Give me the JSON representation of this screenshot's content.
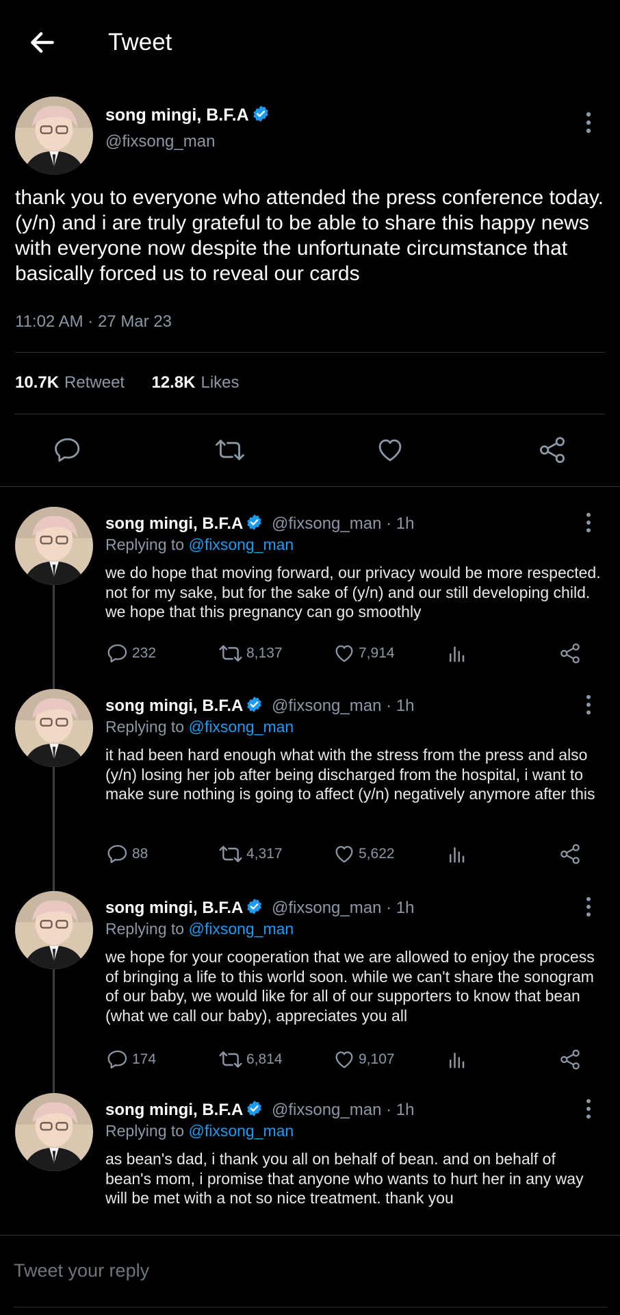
{
  "header": {
    "title": "Tweet"
  },
  "main_tweet": {
    "name": "song mingi, B.F.A",
    "handle": "@fixsong_man",
    "text": "thank you to everyone who attended the press conference today. (y/n) and i are truly grateful to be able to share this happy news with everyone now despite the unfortunate circumstance that basically forced us to reveal our cards",
    "timestamp": "11:02 AM · 27 Mar 23",
    "retweets_count": "10.7K",
    "retweets_label": "Retweet",
    "likes_count": "12.8K",
    "likes_label": "Likes"
  },
  "replies": [
    {
      "name": "song mingi, B.F.A",
      "handle_time": "@fixsong_man · 1h",
      "replying_prefix": "Replying to",
      "replying_to": "@fixsong_man",
      "text": "we do hope that moving forward, our privacy would be more respected. not for my sake, but for the sake of (y/n) and our still developing child. we hope that this pregnancy can go smoothly",
      "comments": "232",
      "retweets": "8,137",
      "likes": "7,914"
    },
    {
      "name": "song mingi, B.F.A",
      "handle_time": "@fixsong_man · 1h",
      "replying_prefix": "Replying to",
      "replying_to": "@fixsong_man",
      "text": "it had been hard enough what with the stress from the press and also (y/n) losing her job after being discharged from the hospital, i want to make sure nothing is going to affect (y/n) negatively anymore after this",
      "comments": "88",
      "retweets": "4,317",
      "likes": "5,622"
    },
    {
      "name": "song mingi, B.F.A",
      "handle_time": "@fixsong_man · 1h",
      "replying_prefix": "Replying to",
      "replying_to": "@fixsong_man",
      "text": "we hope for your cooperation that we are allowed to enjoy the process of bringing a life to this world soon. while we can't share the sonogram of our baby, we would like for all of our supporters to know that bean (what we call our baby), appreciates you all",
      "comments": "174",
      "retweets": "6,814",
      "likes": "9,107"
    },
    {
      "name": "song mingi, B.F.A",
      "handle_time": "@fixsong_man · 1h",
      "replying_prefix": "Replying to",
      "replying_to": "@fixsong_man",
      "text": "as bean's dad, i thank you all on behalf of bean. and on behalf of bean's mom, i promise that anyone who wants to hurt her in any way will be met with a not so nice treatment. thank you"
    }
  ],
  "composer": {
    "placeholder": "Tweet your reply"
  },
  "colors": {
    "background": "#000000",
    "accent": "#1d9bf0",
    "muted": "#8b98a5",
    "divider": "#2f3336"
  },
  "icons": [
    "back-arrow-icon",
    "verified-badge-icon",
    "more-vertical-icon",
    "comment-icon",
    "retweet-icon",
    "like-icon",
    "share-icon",
    "analytics-icon"
  ]
}
